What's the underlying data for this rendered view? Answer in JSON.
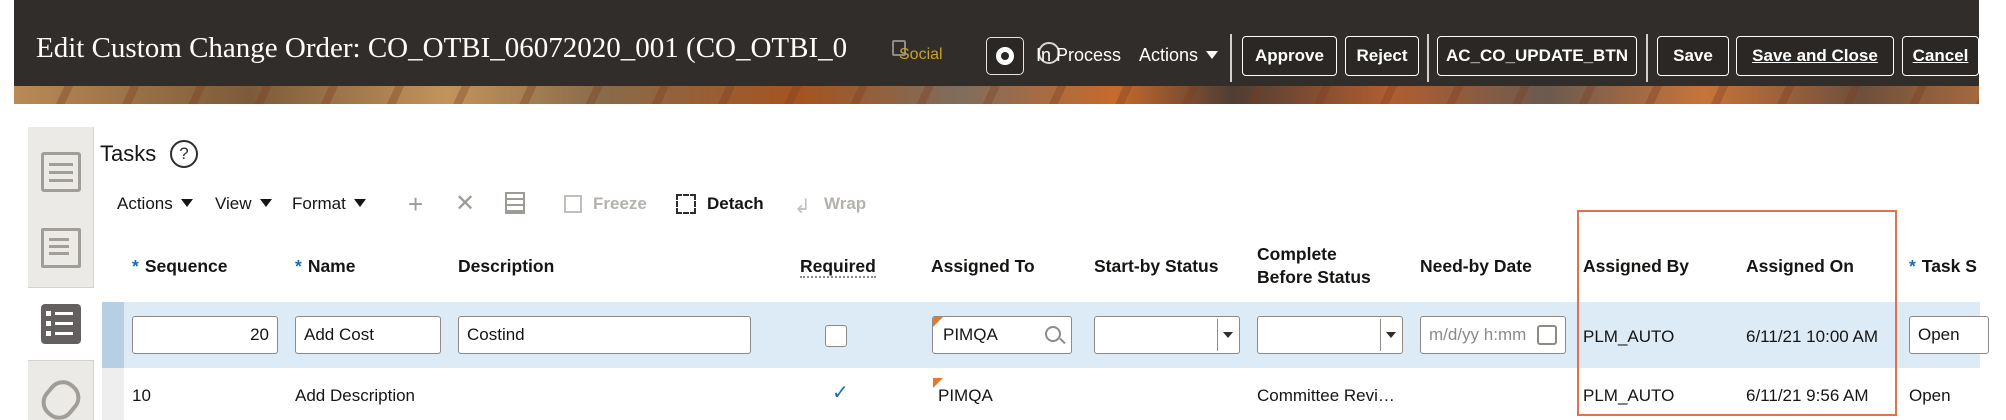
{
  "header": {
    "title": "Edit Custom Change Order: CO_OTBI_06072020_001 (CO_OTBI_0",
    "social_label": "Social",
    "status_text": "In Process",
    "actions_label": "Actions",
    "approve_label": "Approve",
    "reject_label": "Reject",
    "custom_button_label": "AC_CO_UPDATE_BTN",
    "save_label": "Save",
    "save_close_label": "Save and Close",
    "cancel_label": "Cancel"
  },
  "tasks": {
    "title": "Tasks",
    "help_glyph": "?",
    "toolbar": {
      "actions": "Actions",
      "view": "View",
      "format": "Format",
      "freeze": "Freeze",
      "detach": "Detach",
      "wrap": "Wrap"
    },
    "columns": {
      "sequence": "Sequence",
      "name": "Name",
      "description": "Description",
      "required": "Required",
      "assigned_to": "Assigned To",
      "start_by_status": "Start-by Status",
      "complete_before_1": "Complete",
      "complete_before_2": "Before Status",
      "need_by_date": "Need-by Date",
      "assigned_by": "Assigned By",
      "assigned_on": "Assigned On",
      "task_status": "Task S"
    },
    "rows": [
      {
        "sequence": "20",
        "name": "Add Cost",
        "description": "Costind",
        "required": false,
        "assigned_to": "PIMQA",
        "start_by_status": "",
        "complete_before_status": "",
        "need_by_placeholder": "m/d/yy h:mm",
        "assigned_by": "PLM_AUTO",
        "assigned_on": "6/11/21 10:00 AM",
        "task_status": "Open"
      },
      {
        "sequence": "10",
        "name": "Add Description",
        "description": "",
        "required": true,
        "assigned_to": "PIMQA",
        "start_by_status": "",
        "complete_before_status": "Committee Revi…",
        "assigned_by": "PLM_AUTO",
        "assigned_on": "6/11/21 9:56 AM",
        "task_status": "Open"
      }
    ]
  },
  "colors": {
    "header_bg": "#312d2a",
    "selected_row": "#dcebf6",
    "highlight_box": "#e0734f",
    "required_asterisk": "#1d6ab3"
  }
}
